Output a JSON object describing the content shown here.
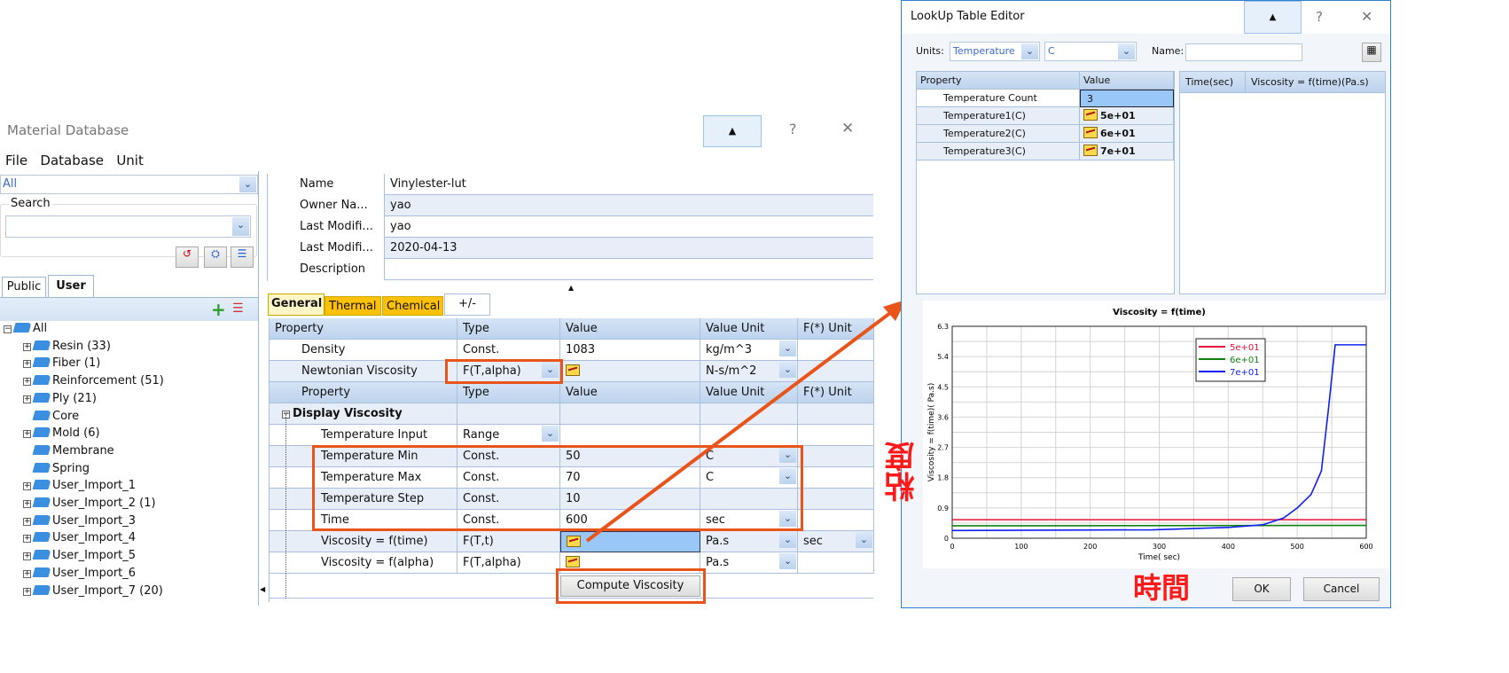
{
  "main_window": {
    "title": "Material Database",
    "menu": [
      "File",
      "Database",
      "Unit"
    ],
    "filter_value": "All",
    "search_label": "Search",
    "search_value": "",
    "tabs": [
      "Public",
      "User"
    ],
    "active_tab": "User",
    "tree": [
      {
        "label": "All",
        "expand": "⊟",
        "indent": 0
      },
      {
        "label": "Resin (33)",
        "expand": "⊞",
        "indent": 1
      },
      {
        "label": "Fiber (1)",
        "expand": "⊞",
        "indent": 1
      },
      {
        "label": "Reinforcement (51)",
        "expand": "⊞",
        "indent": 1
      },
      {
        "label": "Ply (21)",
        "expand": "⊞",
        "indent": 1
      },
      {
        "label": "Core",
        "expand": "",
        "indent": 1
      },
      {
        "label": "Mold (6)",
        "expand": "⊞",
        "indent": 1
      },
      {
        "label": "Membrane",
        "expand": "",
        "indent": 1
      },
      {
        "label": "Spring",
        "expand": "",
        "indent": 1
      },
      {
        "label": "User_Import_1",
        "expand": "⊞",
        "indent": 1
      },
      {
        "label": "User_Import_2 (1)",
        "expand": "⊞",
        "indent": 1
      },
      {
        "label": "User_Import_3",
        "expand": "⊞",
        "indent": 1
      },
      {
        "label": "User_Import_4",
        "expand": "⊞",
        "indent": 1
      },
      {
        "label": "User_Import_5",
        "expand": "⊞",
        "indent": 1
      },
      {
        "label": "User_Import_6",
        "expand": "⊞",
        "indent": 1
      },
      {
        "label": "User_Import_7 (20)",
        "expand": "⊞",
        "indent": 1
      }
    ],
    "help": "?",
    "close": "✕",
    "info": [
      {
        "label": "Name",
        "value": "Vinylester-lut"
      },
      {
        "label": "Owner Na...",
        "value": "yao"
      },
      {
        "label": "Last Modifi...",
        "value": "yao"
      },
      {
        "label": "Last Modifi...",
        "value": "2020-04-13"
      },
      {
        "label": "Description",
        "value": ""
      }
    ],
    "prop_tabs": [
      "General",
      "Thermal",
      "Chemical",
      "+/-"
    ],
    "headers": [
      "Property",
      "Type",
      "Value",
      "Value Unit",
      "F(*) Unit"
    ],
    "rows": [
      {
        "p": "Density",
        "t": "Const.",
        "v": "1083",
        "u": "kg/m^3"
      },
      {
        "p": "Newtonian Viscosity",
        "t": "F(T,alpha)",
        "v": "",
        "u": "N-s/m^2"
      }
    ],
    "group": "Display Viscosity",
    "sub_rows": [
      {
        "p": "Temperature Input",
        "t": "Range",
        "v": "",
        "u": "",
        "f": ""
      },
      {
        "p": "Temperature Min",
        "t": "Const.",
        "v": "50",
        "u": "C",
        "f": ""
      },
      {
        "p": "Temperature Max",
        "t": "Const.",
        "v": "70",
        "u": "C",
        "f": ""
      },
      {
        "p": "Temperature Step",
        "t": "Const.",
        "v": "10",
        "u": "",
        "f": ""
      },
      {
        "p": "Time",
        "t": "Const.",
        "v": "600",
        "u": "sec",
        "f": ""
      },
      {
        "p": "Viscosity = f(time)",
        "t": "F(T,t)",
        "v": "",
        "u": "Pa.s",
        "f": "sec"
      },
      {
        "p": "Viscosity = f(alpha)",
        "t": "F(T,alpha)",
        "v": "",
        "u": "Pa.s",
        "f": ""
      }
    ],
    "compute_button": "Compute Viscosity"
  },
  "dialog": {
    "title": "LookUp Table Editor",
    "help": "?",
    "close": "✕",
    "units_label": "Units:",
    "units_value": "Temperature",
    "unit_value": "C",
    "name_label": "Name:",
    "name_value": "",
    "left_headers": [
      "Property",
      "Value"
    ],
    "left_rows": [
      {
        "p": "Temperature Count",
        "v": "3"
      },
      {
        "p": "Temperature1(C)",
        "v": "5e+01"
      },
      {
        "p": "Temperature2(C)",
        "v": "6e+01"
      },
      {
        "p": "Temperature3(C)",
        "v": "7e+01"
      }
    ],
    "right_headers": [
      "Time(sec)",
      "Viscosity = f(time)(Pa.s)"
    ],
    "ok": "OK",
    "cancel": "Cancel"
  },
  "annotations": {
    "y": "粘度",
    "x": "時間",
    "color": "#ff1a1a"
  },
  "chart_data": {
    "type": "line",
    "title": "Viscosity = f(time)",
    "xlabel": "Time( sec)",
    "ylabel": "Viscosity = f(time)( Pa.s)",
    "xlim": [
      0,
      600
    ],
    "ylim": [
      0,
      6.3
    ],
    "xticks": [
      0,
      100,
      200,
      300,
      400,
      500,
      600
    ],
    "yticks": [
      0,
      0.9,
      1.8,
      2.7,
      3.6,
      4.5,
      5.4,
      6.3
    ],
    "grid": true,
    "legend": "top-right",
    "series": [
      {
        "name": "5e+01",
        "color": "#e8103a",
        "x": [
          0,
          600
        ],
        "y": [
          0.55,
          0.55
        ]
      },
      {
        "name": "6e+01",
        "color": "#108010",
        "x": [
          0,
          600
        ],
        "y": [
          0.37,
          0.38
        ]
      },
      {
        "name": "7e+01",
        "color": "#1020f0",
        "x": [
          0,
          290,
          400,
          450,
          480,
          500,
          520,
          535,
          545,
          555,
          600
        ],
        "y": [
          0.23,
          0.25,
          0.32,
          0.4,
          0.6,
          0.9,
          1.3,
          2.0,
          3.8,
          5.75,
          5.75
        ]
      }
    ]
  }
}
